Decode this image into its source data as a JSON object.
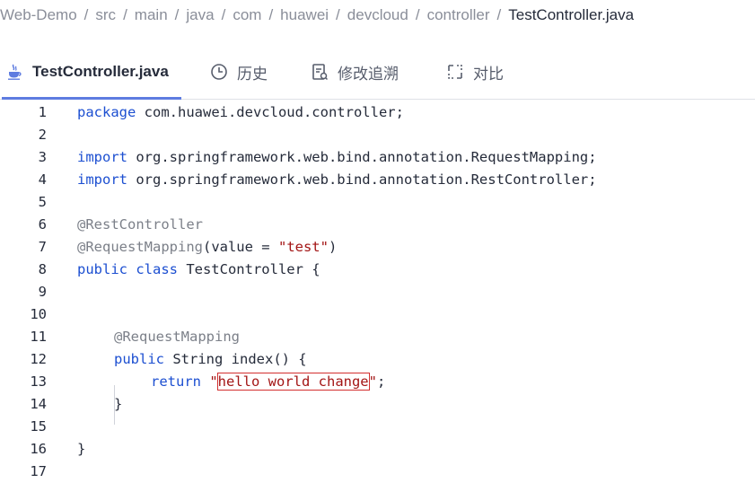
{
  "breadcrumb": {
    "items": [
      "Web-Demo",
      "src",
      "main",
      "java",
      "com",
      "huawei",
      "devcloud",
      "controller"
    ],
    "current": "TestController.java",
    "separator": "/"
  },
  "tabs": {
    "file": "TestController.java",
    "history": "历史",
    "revision": "修改追溯",
    "compare": "对比"
  },
  "code": {
    "line_numbers": [
      "1",
      "2",
      "3",
      "4",
      "5",
      "6",
      "7",
      "8",
      "9",
      "10",
      "11",
      "12",
      "13",
      "14",
      "15",
      "16",
      "17"
    ],
    "l1_kw": "package",
    "l1_rest": " com.huawei.devcloud.controller;",
    "l3_kw": "import",
    "l3_rest": " org.springframework.web.bind.annotation.RequestMapping;",
    "l4_kw": "import",
    "l4_rest": " org.springframework.web.bind.annotation.RestController;",
    "l6_ann": "@RestController",
    "l7_ann": "@RequestMapping",
    "l7_mid": "(value = ",
    "l7_str": "\"test\"",
    "l7_end": ")",
    "l8_kw": "public class",
    "l8_rest": " TestController {",
    "l11_ann": "@RequestMapping",
    "l12_kw": "public",
    "l12_rest": " String index() {",
    "l13_kw": "return",
    "l13_q1": " \"",
    "l13_str": "hello world change",
    "l13_q2": "\"",
    "l13_end": ";",
    "l14": "}",
    "l16": "}"
  },
  "colors": {
    "keyword": "#1c4fd1",
    "annotation": "#7c8089",
    "string": "#a31515",
    "highlight_box": "#d32f2f",
    "active_tab_underline": "#5e7ce0"
  }
}
